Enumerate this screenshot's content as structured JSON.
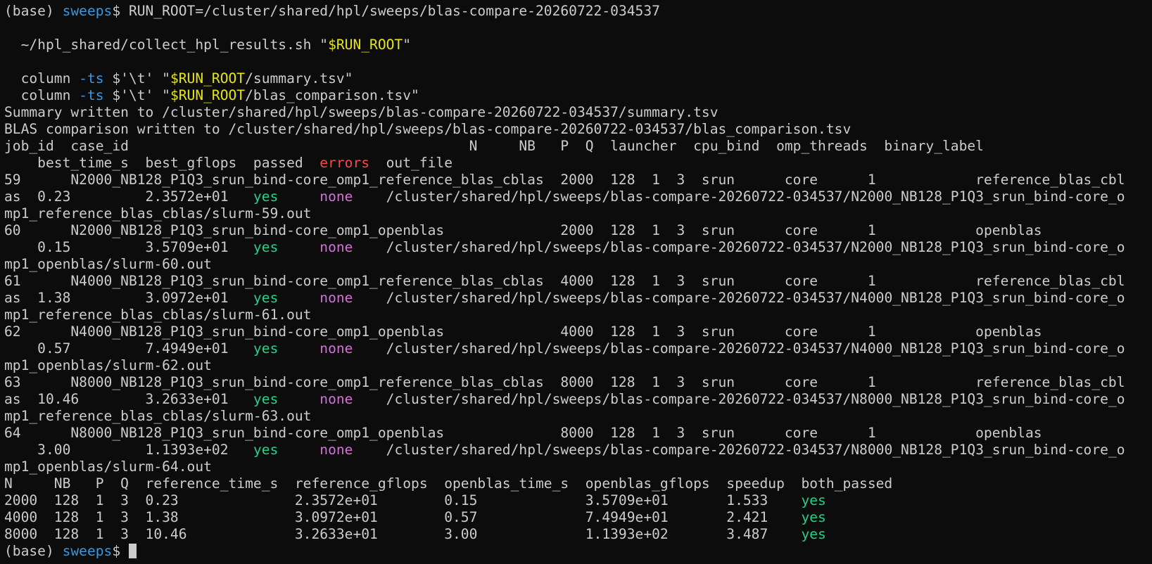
{
  "colors": {
    "background": "#0c0c0c",
    "foreground": "#cccccc",
    "blue": "#3a96dd",
    "yellow": "#e5e510",
    "green": "#23d18b",
    "magenta": "#d670d6",
    "red": "#f14c4c",
    "cursor": "#cccccc"
  },
  "lines": [
    [
      {
        "t": "(base) "
      },
      {
        "t": "sweeps",
        "c": "blue"
      },
      {
        "t": "$ RUN_ROOT=/cluster/shared/hpl/sweeps/blas-compare-20260722-034537"
      }
    ],
    [
      {
        "t": ""
      }
    ],
    [
      {
        "t": "  ~/hpl_shared/collect_hpl_results.sh \""
      },
      {
        "t": "$RUN_ROOT",
        "c": "yellow"
      },
      {
        "t": "\""
      }
    ],
    [
      {
        "t": ""
      }
    ],
    [
      {
        "t": "  column "
      },
      {
        "t": "-ts",
        "c": "blue"
      },
      {
        "t": " $'\\t' \""
      },
      {
        "t": "$RUN_ROOT",
        "c": "yellow"
      },
      {
        "t": "/summary.tsv\""
      }
    ],
    [
      {
        "t": "  column "
      },
      {
        "t": "-ts",
        "c": "blue"
      },
      {
        "t": " $'\\t' \""
      },
      {
        "t": "$RUN_ROOT",
        "c": "yellow"
      },
      {
        "t": "/blas_comparison.tsv\""
      }
    ],
    [
      {
        "t": "Summary written to /cluster/shared/hpl/sweeps/blas-compare-20260722-034537/summary.tsv"
      }
    ],
    [
      {
        "t": "BLAS comparison written to /cluster/shared/hpl/sweeps/blas-compare-20260722-034537/blas_comparison.tsv"
      }
    ],
    [
      {
        "t": "job_id  case_id                                         N     NB   P  Q  launcher  cpu_bind  omp_threads  binary_label"
      }
    ],
    [
      {
        "t": "    best_time_s  best_gflops  passed  "
      },
      {
        "t": "errors",
        "c": "red"
      },
      {
        "t": "  out_file"
      }
    ],
    [
      {
        "t": "59      N2000_NB128_P1Q3_srun_bind-core_omp1_reference_blas_cblas  2000  128  1  3  srun      core      1            reference_blas_cbl"
      }
    ],
    [
      {
        "t": "as  0.23         2.3572e+01   "
      },
      {
        "t": "yes",
        "c": "green"
      },
      {
        "t": "     "
      },
      {
        "t": "none",
        "c": "magenta"
      },
      {
        "t": "    /cluster/shared/hpl/sweeps/blas-compare-20260722-034537/N2000_NB128_P1Q3_srun_bind-core_o"
      }
    ],
    [
      {
        "t": "mp1_reference_blas_cblas/slurm-59.out"
      }
    ],
    [
      {
        "t": "60      N2000_NB128_P1Q3_srun_bind-core_omp1_openblas              2000  128  1  3  srun      core      1            openblas"
      }
    ],
    [
      {
        "t": "    0.15         3.5709e+01   "
      },
      {
        "t": "yes",
        "c": "green"
      },
      {
        "t": "     "
      },
      {
        "t": "none",
        "c": "magenta"
      },
      {
        "t": "    /cluster/shared/hpl/sweeps/blas-compare-20260722-034537/N2000_NB128_P1Q3_srun_bind-core_o"
      }
    ],
    [
      {
        "t": "mp1_openblas/slurm-60.out"
      }
    ],
    [
      {
        "t": "61      N4000_NB128_P1Q3_srun_bind-core_omp1_reference_blas_cblas  4000  128  1  3  srun      core      1            reference_blas_cbl"
      }
    ],
    [
      {
        "t": "as  1.38         3.0972e+01   "
      },
      {
        "t": "yes",
        "c": "green"
      },
      {
        "t": "     "
      },
      {
        "t": "none",
        "c": "magenta"
      },
      {
        "t": "    /cluster/shared/hpl/sweeps/blas-compare-20260722-034537/N4000_NB128_P1Q3_srun_bind-core_o"
      }
    ],
    [
      {
        "t": "mp1_reference_blas_cblas/slurm-61.out"
      }
    ],
    [
      {
        "t": "62      N4000_NB128_P1Q3_srun_bind-core_omp1_openblas              4000  128  1  3  srun      core      1            openblas"
      }
    ],
    [
      {
        "t": "    0.57         7.4949e+01   "
      },
      {
        "t": "yes",
        "c": "green"
      },
      {
        "t": "     "
      },
      {
        "t": "none",
        "c": "magenta"
      },
      {
        "t": "    /cluster/shared/hpl/sweeps/blas-compare-20260722-034537/N4000_NB128_P1Q3_srun_bind-core_o"
      }
    ],
    [
      {
        "t": "mp1_openblas/slurm-62.out"
      }
    ],
    [
      {
        "t": "63      N8000_NB128_P1Q3_srun_bind-core_omp1_reference_blas_cblas  8000  128  1  3  srun      core      1            reference_blas_cbl"
      }
    ],
    [
      {
        "t": "as  10.46        3.2633e+01   "
      },
      {
        "t": "yes",
        "c": "green"
      },
      {
        "t": "     "
      },
      {
        "t": "none",
        "c": "magenta"
      },
      {
        "t": "    /cluster/shared/hpl/sweeps/blas-compare-20260722-034537/N8000_NB128_P1Q3_srun_bind-core_o"
      }
    ],
    [
      {
        "t": "mp1_reference_blas_cblas/slurm-63.out"
      }
    ],
    [
      {
        "t": "64      N8000_NB128_P1Q3_srun_bind-core_omp1_openblas              8000  128  1  3  srun      core      1            openblas"
      }
    ],
    [
      {
        "t": "    3.00         1.1393e+02   "
      },
      {
        "t": "yes",
        "c": "green"
      },
      {
        "t": "     "
      },
      {
        "t": "none",
        "c": "magenta"
      },
      {
        "t": "    /cluster/shared/hpl/sweeps/blas-compare-20260722-034537/N8000_NB128_P1Q3_srun_bind-core_o"
      }
    ],
    [
      {
        "t": "mp1_openblas/slurm-64.out"
      }
    ],
    [
      {
        "t": "N     NB   P  Q  reference_time_s  reference_gflops  openblas_time_s  openblas_gflops  speedup  both_passed"
      }
    ],
    [
      {
        "t": "2000  128  1  3  0.23              2.3572e+01        0.15             3.5709e+01       1.533    "
      },
      {
        "t": "yes",
        "c": "green"
      }
    ],
    [
      {
        "t": "4000  128  1  3  1.38              3.0972e+01        0.57             7.4949e+01       2.421    "
      },
      {
        "t": "yes",
        "c": "green"
      }
    ],
    [
      {
        "t": "8000  128  1  3  10.46             3.2633e+01        3.00             1.1393e+02       3.487    "
      },
      {
        "t": "yes",
        "c": "green"
      }
    ],
    [
      {
        "t": "(base) "
      },
      {
        "t": "sweeps",
        "c": "blue"
      },
      {
        "t": "$ "
      },
      {
        "cursor": true
      }
    ]
  ]
}
